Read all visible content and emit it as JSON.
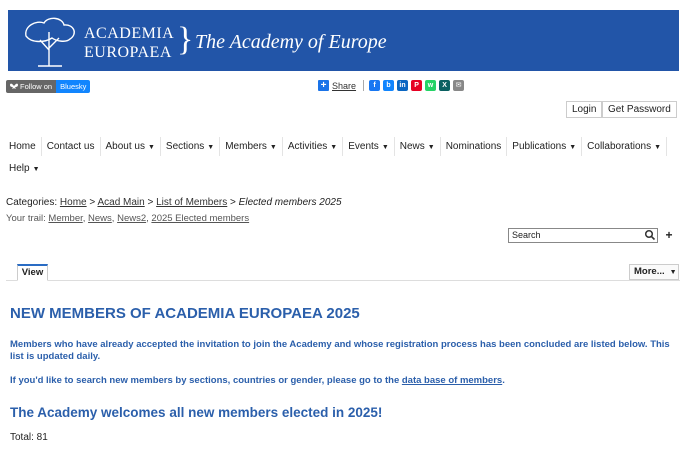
{
  "banner": {
    "brand_line1": "ACADEMIA",
    "brand_line2": "EUROPAEA",
    "tagline": "The Academy of Europe",
    "bg_color": "#2255a8"
  },
  "follow": {
    "label": "Follow on",
    "service": "Bluesky"
  },
  "share": {
    "label": "Share",
    "icons": [
      "facebook-icon",
      "bluesky-icon",
      "linkedin-icon",
      "pinterest-icon",
      "whatsapp-icon",
      "xing-icon",
      "email-icon"
    ]
  },
  "auth": {
    "login": "Login",
    "get_password": "Get Password"
  },
  "nav": {
    "row1": [
      {
        "label": "Home",
        "caret": false
      },
      {
        "label": "Contact us",
        "caret": false
      },
      {
        "label": "About us",
        "caret": true
      },
      {
        "label": "Sections",
        "caret": true
      },
      {
        "label": "Members",
        "caret": true
      },
      {
        "label": "Activities",
        "caret": true
      },
      {
        "label": "Events",
        "caret": true
      },
      {
        "label": "News",
        "caret": true
      },
      {
        "label": "Nominations",
        "caret": false
      },
      {
        "label": "Publications",
        "caret": true
      },
      {
        "label": "Collaborations",
        "caret": true
      }
    ],
    "row2": [
      {
        "label": "Help",
        "caret": true
      }
    ]
  },
  "breadcrumb": {
    "prefix": "Categories:",
    "links": [
      "Home",
      "Acad Main",
      "List of Members"
    ],
    "current": "Elected members 2025"
  },
  "trail": {
    "prefix": "Your trail:",
    "links": [
      "Member",
      "News",
      "News2",
      "2025 Elected members"
    ]
  },
  "search": {
    "placeholder": "Search"
  },
  "tabs": {
    "view": "View",
    "more": "More..."
  },
  "content": {
    "title": "NEW MEMBERS OF ACADEMIA EUROPAEA 2025",
    "intro": "Members who have already accepted the invitation to join the Academy and whose registration process has been concluded are listed below. This list is updated daily.",
    "search_note_pre": "If you'd like to search new members by sections, countries or gender, please go to the ",
    "search_note_link": "data base of members",
    "search_note_post": ".",
    "welcome": "The Academy welcomes all new members elected in 2025!",
    "total": "Total: 81",
    "accent_color": "#2b5fab"
  }
}
